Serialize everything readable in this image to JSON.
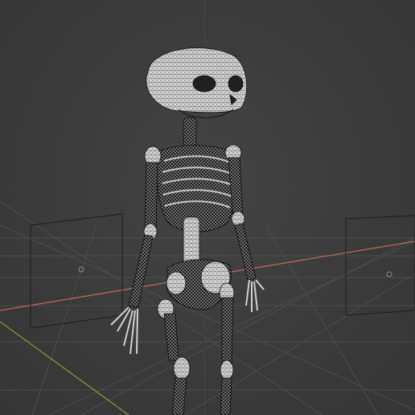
{
  "viewport": {
    "type": "3d-viewport",
    "shading_mode": "wireframe",
    "background_color": "#3a3a3a",
    "grid_color": "#555555",
    "x_axis_color": "#c86a5a",
    "y_axis_color": "#7fa33a",
    "mesh_color": "#d9d9d9",
    "object": "skeleton-mesh",
    "cameras_visible": 2
  }
}
